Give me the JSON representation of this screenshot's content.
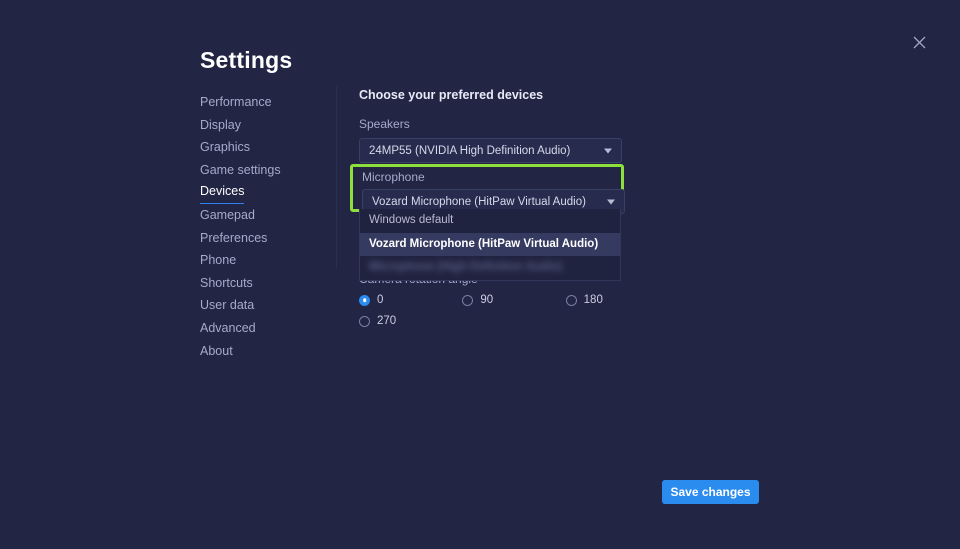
{
  "window": {
    "title": "Settings",
    "close_icon": "close-icon"
  },
  "sidebar": {
    "items": [
      {
        "label": "Performance",
        "active": false
      },
      {
        "label": "Display",
        "active": false
      },
      {
        "label": "Graphics",
        "active": false
      },
      {
        "label": "Game settings",
        "active": false
      },
      {
        "label": "Devices",
        "active": true
      },
      {
        "label": "Gamepad",
        "active": false
      },
      {
        "label": "Preferences",
        "active": false
      },
      {
        "label": "Phone",
        "active": false
      },
      {
        "label": "Shortcuts",
        "active": false
      },
      {
        "label": "User data",
        "active": false
      },
      {
        "label": "Advanced",
        "active": false
      },
      {
        "label": "About",
        "active": false
      }
    ]
  },
  "devices": {
    "heading": "Choose your preferred devices",
    "speakers": {
      "label": "Speakers",
      "value": "24MP55 (NVIDIA High Definition Audio)",
      "caret_icon": "chevron-down-icon"
    },
    "microphone": {
      "label": "Microphone",
      "value": "Vozard Microphone (HitPaw Virtual Audio)",
      "caret_icon": "chevron-down-icon",
      "highlighted": true,
      "highlight_color": "#8de03c",
      "expanded": true,
      "options": [
        {
          "label": "Windows default",
          "selected": false,
          "blurred": false
        },
        {
          "label": "Vozard Microphone (HitPaw Virtual Audio)",
          "selected": true,
          "blurred": false
        },
        {
          "label": "Microphone (High Definition Audio)",
          "selected": false,
          "blurred": true
        }
      ]
    },
    "camera_rotation": {
      "label": "Camera rotation angle",
      "options": [
        {
          "label": "0",
          "checked": true
        },
        {
          "label": "90",
          "checked": false
        },
        {
          "label": "180",
          "checked": false
        },
        {
          "label": "270",
          "checked": false
        }
      ]
    }
  },
  "footer": {
    "save_label": "Save changes"
  },
  "colors": {
    "background": "#222543",
    "accent_blue": "#2b8cf0",
    "highlight_green": "#8de03c"
  }
}
